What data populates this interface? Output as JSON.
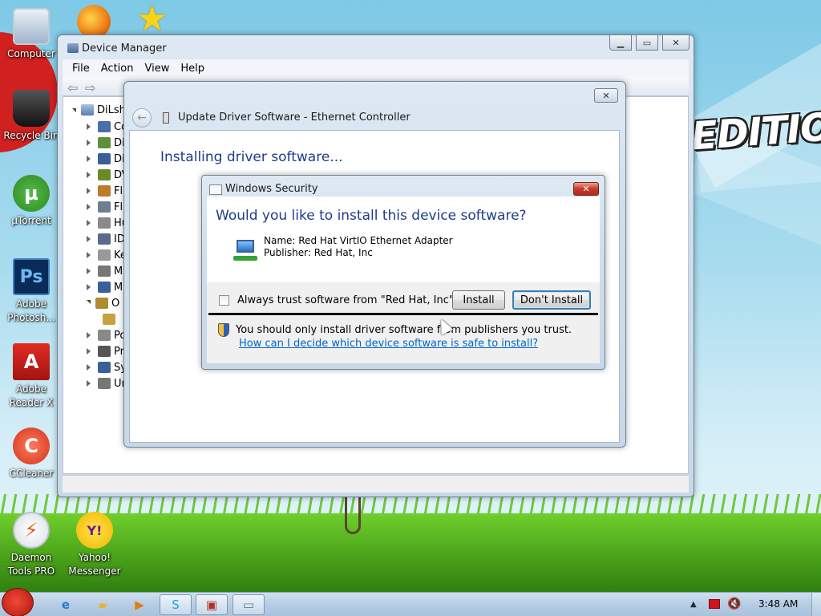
{
  "desktop": {
    "wallpaper_text": "EDITION",
    "icons": [
      {
        "label": "Computer",
        "icon": "computer-icon"
      },
      {
        "label": "Recycle Bin",
        "icon": "recycle-bin-icon"
      },
      {
        "label": "µTorrent",
        "icon": "utorrent-icon",
        "glyph": "µ"
      },
      {
        "label": "Adobe Photosh...",
        "icon": "photoshop-icon",
        "glyph": "Ps"
      },
      {
        "label": "Adobe Reader X",
        "icon": "adobe-reader-icon",
        "glyph": "A"
      },
      {
        "label": "CCleaner",
        "icon": "ccleaner-icon",
        "glyph": "C"
      },
      {
        "label": "Daemon Tools PRO",
        "icon": "daemon-tools-icon",
        "glyph": "⚡"
      },
      {
        "label": "Yahoo! Messenger",
        "icon": "yahoo-messenger-icon",
        "glyph": "Y!"
      }
    ]
  },
  "device_manager": {
    "title": "Device Manager",
    "menu": [
      "File",
      "Action",
      "View",
      "Help"
    ],
    "root_label": "DiLsh",
    "tree": [
      "Co",
      "Di",
      "Di",
      "DV",
      "Fl",
      "Fl",
      "Hu",
      "ID",
      "Ke",
      "M",
      "M",
      "O",
      "",
      "Po",
      "Pr",
      "Sy",
      "Ur"
    ]
  },
  "update_driver": {
    "title": "Update Driver Software - Ethernet Controller",
    "status": "Installing driver software..."
  },
  "windows_security": {
    "title": "Windows Security",
    "question": "Would you like to install this device software?",
    "name_line": "Name: Red Hat VirtIO Ethernet Adapter",
    "publisher_line": "Publisher: Red Hat, Inc",
    "always_trust_label": "Always trust software from \"Red Hat, Inc\".",
    "always_trust_checked": false,
    "install_label": "Install",
    "dont_install_label": "Don't Install",
    "warning_text": "You should only install driver software from publishers you trust.",
    "help_link": "How can I decide which device software is safe to install?"
  },
  "taskbar": {
    "clock": "3:48 AM",
    "items": [
      "internet-explorer-icon",
      "folder-icon",
      "media-player-icon",
      "skype-icon",
      "device-manager-icon",
      "window-icon"
    ]
  },
  "colors": {
    "heading_blue": "#1f3b8a",
    "link_blue": "#0066cc",
    "close_red": "#c7392b"
  }
}
